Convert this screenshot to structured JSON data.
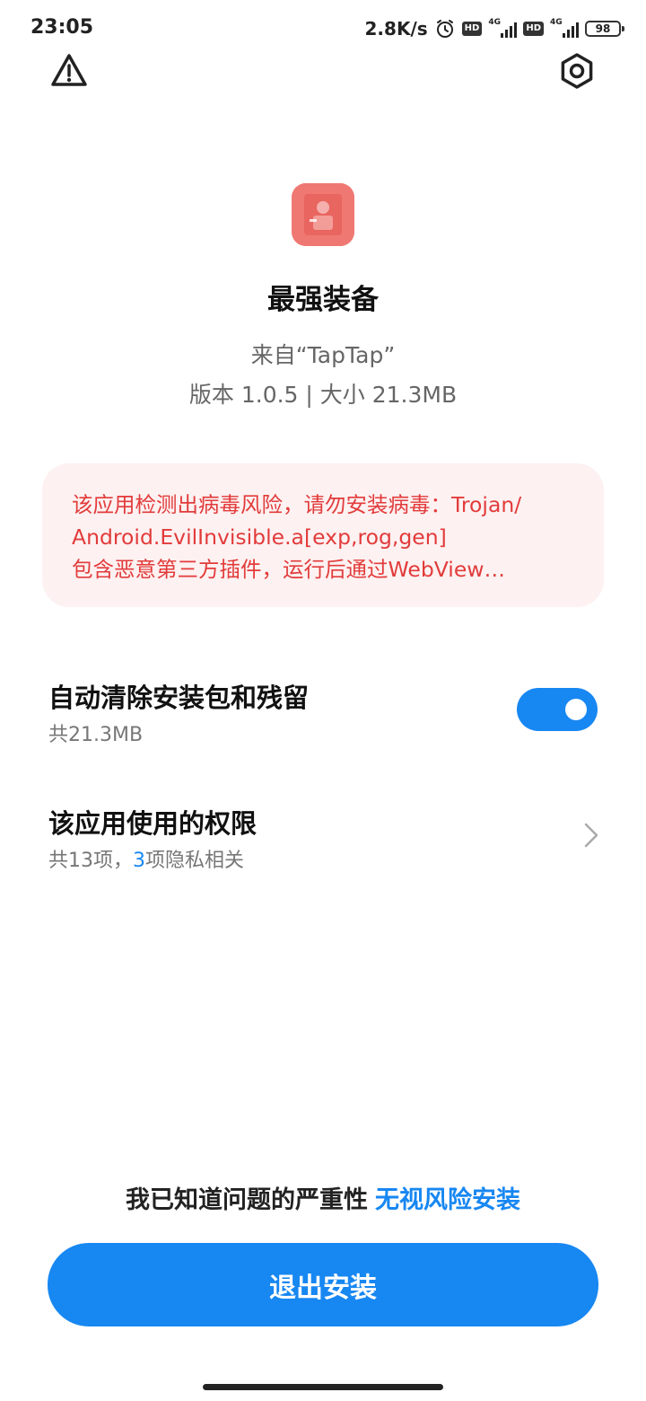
{
  "status_bar": {
    "time": "23:05",
    "net_speed": "2.8K/s",
    "hd_label": "HD",
    "signal_label": "4G",
    "battery": "98",
    "icons": [
      "alarm-icon",
      "signal-icon",
      "battery-icon"
    ]
  },
  "header": {
    "warning_icon": "warning-triangle-icon",
    "settings_icon": "gear-icon"
  },
  "app": {
    "name": "最强装备",
    "source": "来自“TapTap”",
    "meta": "版本 1.0.5 | 大小 21.3MB"
  },
  "risk": {
    "lines": [
      "该应用检测出病毒风险，请勿安装病毒：Trojan/",
      "Android.EvilInvisible.a[exp,rog,gen]",
      "包含恶意第三方插件，运行后通过WebView…"
    ],
    "color": "#e23b3b",
    "background": "#fdf1f1"
  },
  "auto_clean": {
    "title": "自动清除安装包和残留",
    "subtitle": "共21.3MB",
    "enabled": true
  },
  "permissions": {
    "title": "该应用使用的权限",
    "subtitle_prefix": "共13项，",
    "privacy_count": "3",
    "subtitle_suffix": "项隐私相关"
  },
  "footer": {
    "ack_text": "我已知道问题的严重性",
    "ignore_link": "无视风险安装",
    "exit_button": "退出安装"
  },
  "colors": {
    "accent": "#1787f2",
    "danger": "#e23b3b"
  }
}
